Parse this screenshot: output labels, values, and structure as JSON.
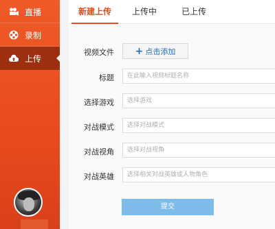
{
  "sidebar": {
    "items": [
      {
        "label": "直播",
        "icon": "video-camera-icon"
      },
      {
        "label": "录制",
        "icon": "film-reel-icon"
      },
      {
        "label": "上传",
        "icon": "cloud-upload-icon",
        "active": true
      }
    ]
  },
  "tabs": [
    {
      "label": "新建上传",
      "active": true
    },
    {
      "label": "上传中"
    },
    {
      "label": "已上传"
    }
  ],
  "form": {
    "video_file_label": "视频文件",
    "add_button": "点击添加",
    "title_label": "标题",
    "title_placeholder": "在此输入视频标题名称",
    "game_label": "选择游戏",
    "game_placeholder": "选择游戏",
    "mode_label": "对战模式",
    "mode_placeholder": "选择对战模式",
    "view_label": "对战视角",
    "view_placeholder": "选择对战视角",
    "hero_label": "对战英雄",
    "hero_placeholder": "选择相关对战英雄或人物角色",
    "submit": "提交"
  },
  "colors": {
    "accent": "#e84a1e",
    "active_nav": "#9c2f10",
    "submit": "#7dbbe9",
    "link": "#1e6fc4"
  }
}
